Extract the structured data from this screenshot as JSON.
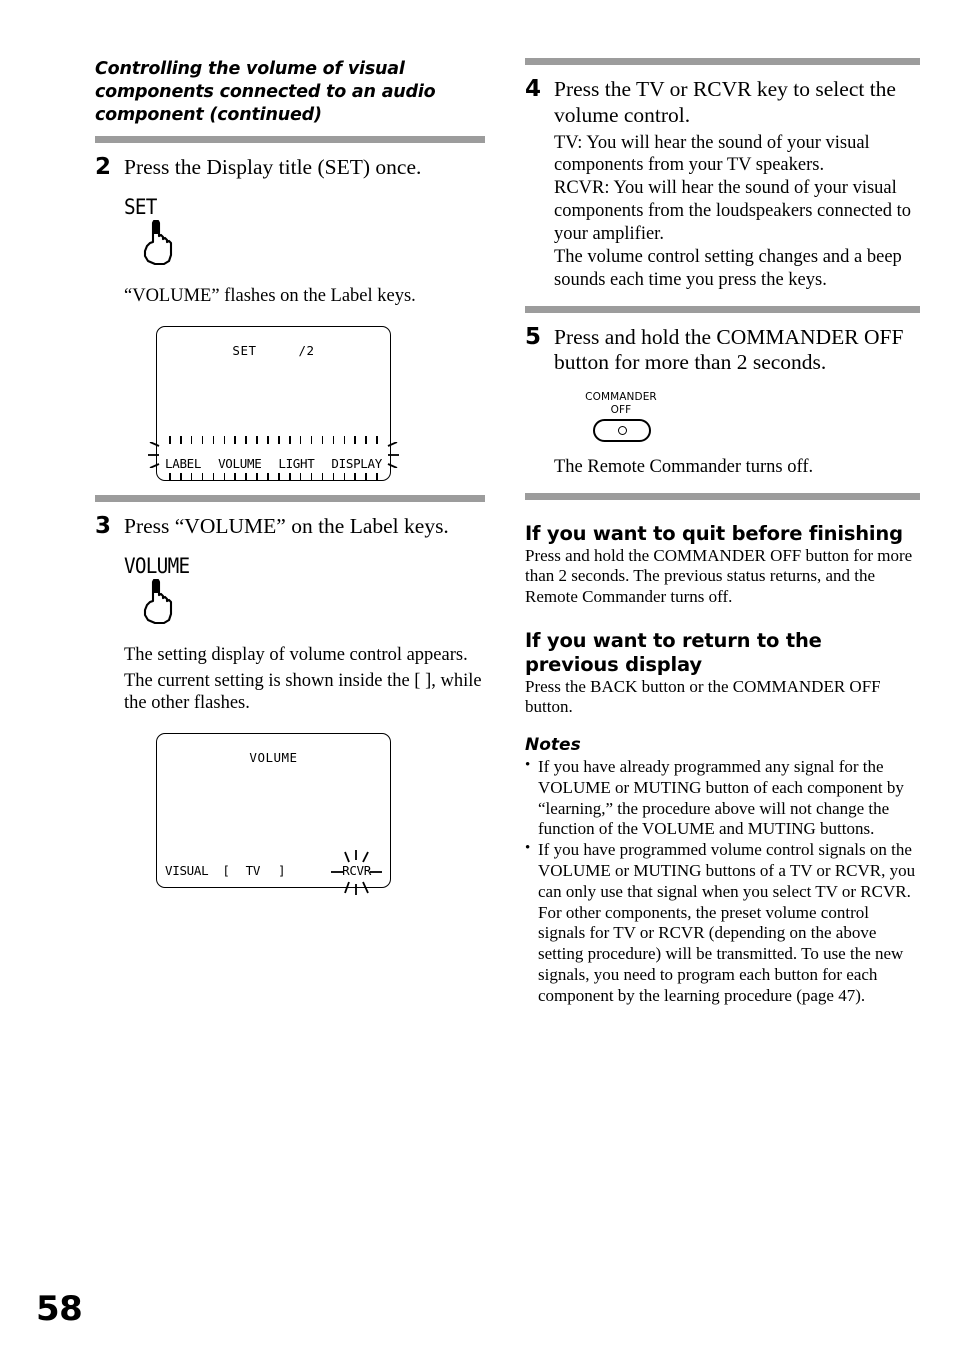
{
  "page": {
    "folio": "58"
  },
  "left": {
    "running_head": "Controlling the volume of visual components connected to an audio component (continued)",
    "step2": {
      "number": "2",
      "title": "Press the Display title (SET) once.",
      "keycap": "SET",
      "hand_icon": "pointing-hand-icon",
      "result": "“VOLUME” flashes on the Label keys.",
      "lcd": {
        "top_left": "SET",
        "top_right": "/2",
        "label_keys": [
          "LABEL",
          "VOLUME",
          "LIGHT",
          "DISPLAY"
        ],
        "flashing": "label-row"
      }
    },
    "step3": {
      "number": "3",
      "title": "Press “VOLUME” on the Label keys.",
      "keycap": "VOLUME",
      "hand_icon": "pointing-hand-icon",
      "result_line1": "The setting display of volume control appears.",
      "result_line2": "The current setting is shown inside the [ ], while the other flashes.",
      "lcd": {
        "title": "VOLUME",
        "bottom_label": "VISUAL",
        "bracket_open": "[",
        "bracket_value": "TV",
        "bracket_close": "]",
        "flashing_item": "RCVR"
      }
    }
  },
  "right": {
    "step4": {
      "number": "4",
      "title": "Press the TV or RCVR key to select the volume control.",
      "lines": [
        "TV: You will hear the sound of your visual components from your TV speakers.",
        "RCVR: You will hear the sound of your visual components from the loudspeakers connected to your amplifier.",
        "The volume control setting changes and a beep sounds each time you press the keys."
      ]
    },
    "step5": {
      "number": "5",
      "title": "Press and hold the COMMANDER OFF button for more than 2 seconds.",
      "button_label_line1": "COMMANDER",
      "button_label_line2": "OFF",
      "button_icon": "commander-off-button",
      "result": "The Remote Commander turns off."
    },
    "quit_section": {
      "heading": "If you want to quit before finishing",
      "body": "Press and hold the COMMANDER OFF button for more than 2 seconds. The previous status returns, and the Remote Commander turns off."
    },
    "return_section": {
      "heading": "If you want to return to the previous display",
      "body": "Press the BACK button or the COMMANDER OFF button."
    },
    "notes": {
      "heading": "Notes",
      "items": [
        "If you have already programmed any signal for the VOLUME or MUTING button of each component by “learning,” the procedure above will not change the function of the VOLUME and MUTING buttons.",
        "If you have programmed volume control signals on the VOLUME or MUTING buttons of a TV or RCVR, you can only use that signal when you select TV or RCVR. For other components, the preset volume control signals for TV or RCVR (depending on the above setting procedure) will be transmitted. To use the new signals, you need to program each button for each component by the learning procedure (page 47)."
      ]
    }
  },
  "colors": {
    "rule": "#9c9c9c",
    "text": "#000000",
    "background": "#ffffff"
  }
}
